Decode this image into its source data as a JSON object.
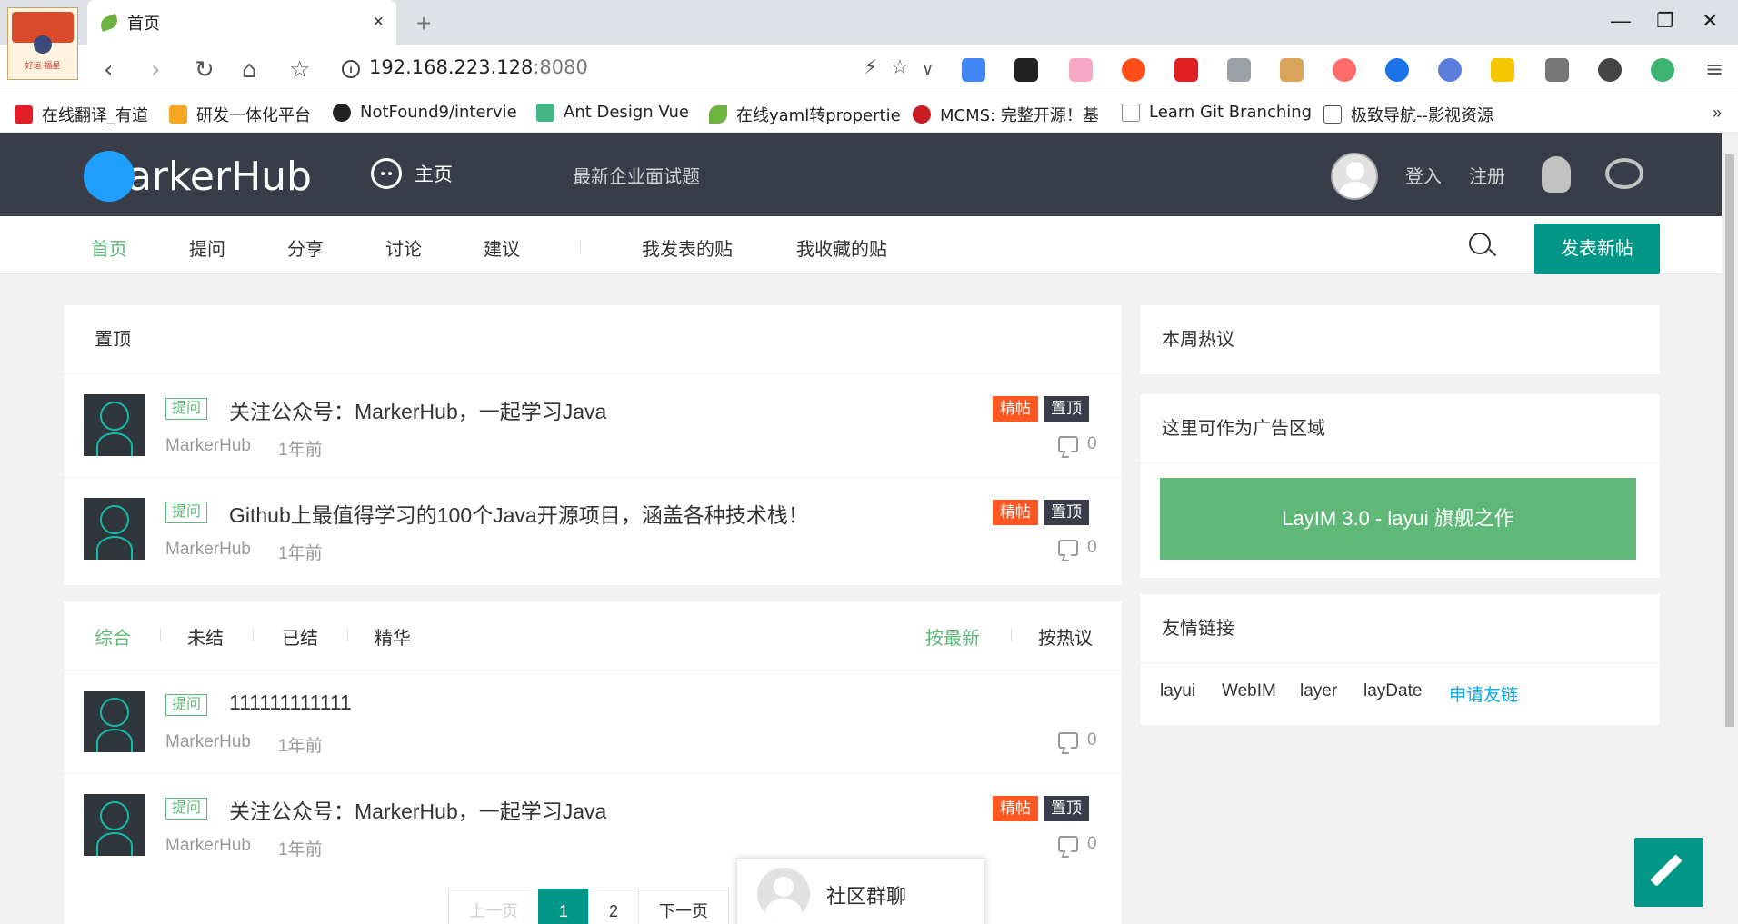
{
  "browser": {
    "tab_title": "首页",
    "tab_close": "×",
    "new_tab": "+",
    "url_host": "192.168.223.128",
    "url_port": ":8080",
    "window_controls": [
      "—",
      "❐",
      "✕"
    ],
    "bookmarks": [
      {
        "label": "在线翻译_有道",
        "icon": "youdao-icon",
        "color": "#e21f26"
      },
      {
        "label": "研发一体化平台",
        "icon": "platform-icon",
        "color": "#f5a623"
      },
      {
        "label": "NotFound9/intervie",
        "icon": "github-icon",
        "color": "#222222"
      },
      {
        "label": "Ant Design Vue",
        "icon": "vue-icon",
        "color": "#41b883"
      },
      {
        "label": "在线yaml转propertie",
        "icon": "spring-leaf-icon",
        "color": "#6db33f"
      },
      {
        "label": "MCMS: 完整开源！基",
        "icon": "gitee-icon",
        "color": "#c71d23"
      },
      {
        "label": "Learn Git Branching",
        "icon": "document-icon",
        "color": "#888888"
      },
      {
        "label": "极致导航--影视资源",
        "icon": "nav-icon",
        "color": "#555555"
      }
    ],
    "bookmarks_more": "»"
  },
  "header": {
    "logo_text": "MarkerHub",
    "home_label": "主页",
    "interview_label": "最新企业面试题",
    "login_label": "登入",
    "register_label": "注册"
  },
  "subnav": {
    "items": [
      "首页",
      "提问",
      "分享",
      "讨论",
      "建议"
    ],
    "my_posts": "我发表的贴",
    "my_favorites": "我收藏的贴",
    "new_post_button": "发表新帖"
  },
  "pinned": {
    "title": "置顶",
    "posts": [
      {
        "tag": "提问",
        "title": "关注公众号：MarkerHub，一起学习Java",
        "author": "MarkerHub",
        "time": "1年前",
        "badge_jing": "精帖",
        "badge_top": "置顶",
        "comments": "0"
      },
      {
        "tag": "提问",
        "title": "Github上最值得学习的100个Java开源项目，涵盖各种技术栈！",
        "author": "MarkerHub",
        "time": "1年前",
        "badge_jing": "精帖",
        "badge_top": "置顶",
        "comments": "0"
      }
    ]
  },
  "list": {
    "filters": [
      "综合",
      "未结",
      "已结",
      "精华"
    ],
    "sort_new": "按最新",
    "sort_hot": "按热议",
    "posts": [
      {
        "tag": "提问",
        "title": "111111111111",
        "author": "MarkerHub",
        "time": "1年前",
        "comments": "0"
      },
      {
        "tag": "提问",
        "title": "关注公众号：MarkerHub，一起学习Java",
        "author": "MarkerHub",
        "time": "1年前",
        "badge_jing": "精帖",
        "badge_top": "置顶",
        "comments": "0"
      }
    ],
    "pager": {
      "prev": "上一页",
      "pages": [
        "1",
        "2"
      ],
      "next": "下一页"
    }
  },
  "sidebar": {
    "hot_title": "本周热议",
    "ad_title": "这里可作为广告区域",
    "ad_banner": "LayIM 3.0 - layui 旗舰之作",
    "links_title": "友情链接",
    "links": [
      "layui",
      "WebIM",
      "layer",
      "layDate"
    ],
    "apply_link": "申请友链"
  },
  "chat_popup": {
    "label": "社区群聊"
  },
  "colors": {
    "header_bg": "#393d49",
    "accent_green": "#5fb878",
    "primary_teal": "#009688",
    "badge_orange": "#ff5722",
    "link_blue": "#01aaed"
  }
}
